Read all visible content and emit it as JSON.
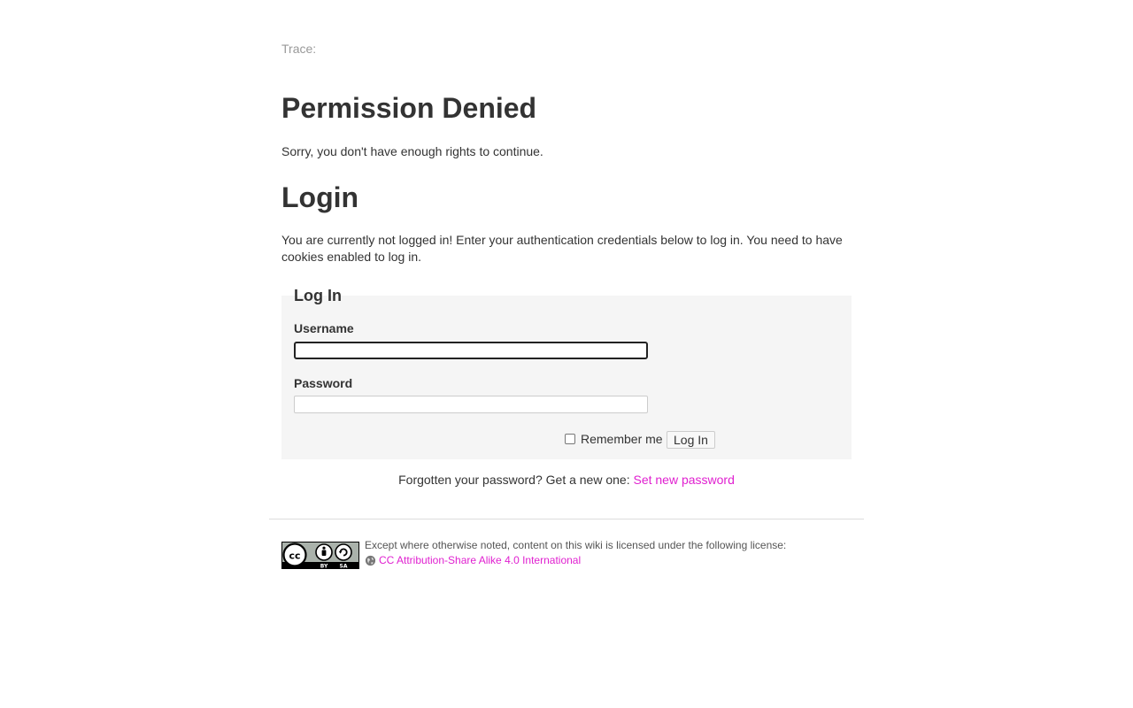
{
  "trace": "Trace:",
  "denied": {
    "title": "Permission Denied",
    "message": "Sorry, you don't have enough rights to continue."
  },
  "login": {
    "title": "Login",
    "notice": "You are currently not logged in! Enter your authentication credentials below to log in. You need to have cookies enabled to log in."
  },
  "form": {
    "legend": "Log In",
    "username_label": "Username",
    "username_value": "",
    "password_label": "Password",
    "password_value": "",
    "remember_label": "Remember me",
    "remember_checked": false,
    "submit_label": "Log In"
  },
  "forgot": {
    "text": "Forgotten your password? Get a new one:",
    "link_label": "Set new password"
  },
  "footer": {
    "license_intro": "Except where otherwise noted, content on this wiki is licensed under the following license:",
    "license_link": "CC Attribution-Share Alike 4.0 International",
    "badge_by": "BY",
    "badge_sa": "SA"
  },
  "colors": {
    "link": "#e020d0",
    "form_bg": "#f5f5f5"
  }
}
